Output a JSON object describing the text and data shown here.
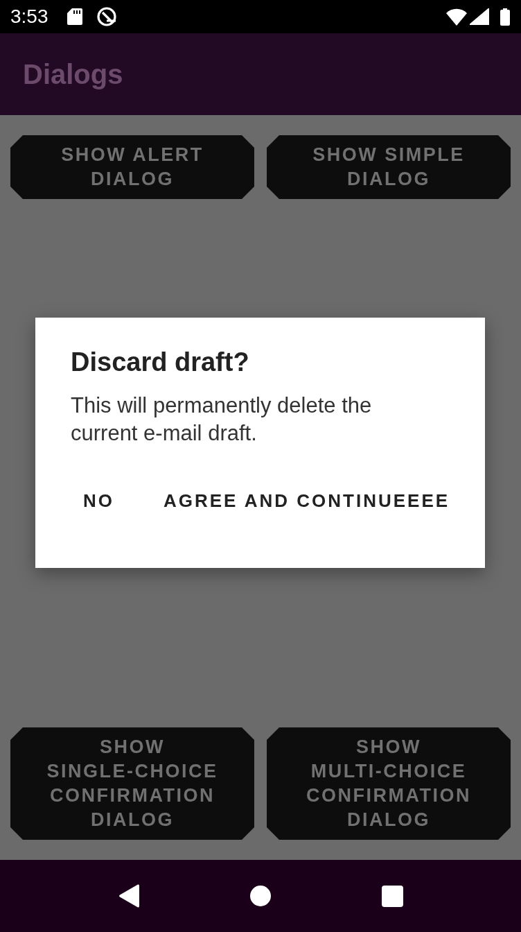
{
  "status_bar": {
    "time": "3:53"
  },
  "app_bar": {
    "title": "Dialogs"
  },
  "buttons": [
    {
      "label": "SHOW ALERT DIALOG"
    },
    {
      "label": "SHOW SIMPLE DIALOG"
    },
    {
      "label": "SHOW SINGLE-CHOICE CONFIRMATION DIALOG"
    },
    {
      "label": "SHOW MULTI-CHOICE CONFIRMATION DIALOG"
    }
  ],
  "dialog": {
    "title": "Discard draft?",
    "message": "This will permanently delete the current e-mail draft.",
    "actions": [
      {
        "label": "NO"
      },
      {
        "label": "AGREE AND CONTINUEEEE"
      }
    ]
  }
}
